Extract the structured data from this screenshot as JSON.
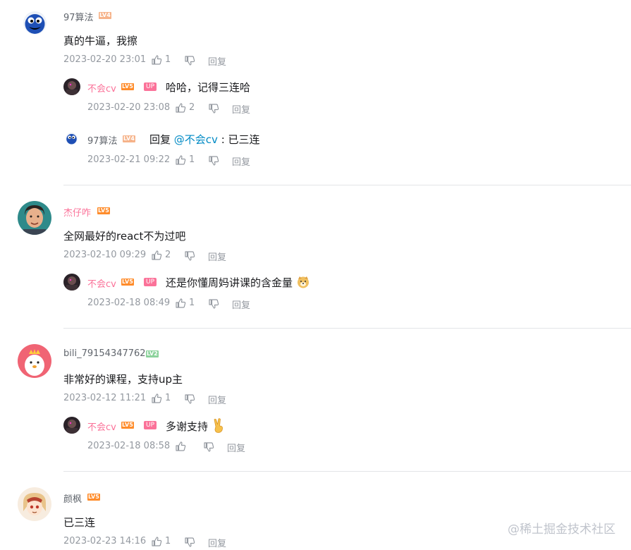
{
  "comments": [
    {
      "user": "97算法",
      "level": "LV4",
      "text": "真的牛逼，我擦",
      "time": "2023-02-20 23:01",
      "likes": "1",
      "reply_label": "回复",
      "replies": [
        {
          "user": "不会cv",
          "level": "LV5",
          "up": "UP",
          "text": "哈哈，记得三连哈",
          "time": "2023-02-20 23:08",
          "likes": "2",
          "reply_label": "回复"
        },
        {
          "user": "97算法",
          "level": "LV4",
          "reply_prefix": "回复",
          "mention": "@不会cv",
          "text": ": 已三连",
          "time": "2023-02-21 09:22",
          "likes": "1",
          "reply_label": "回复"
        }
      ]
    },
    {
      "user": "杰仔咋",
      "level": "LV5",
      "text": "全网最好的react不为过吧",
      "time": "2023-02-10 09:29",
      "likes": "2",
      "reply_label": "回复",
      "replies": [
        {
          "user": "不会cv",
          "level": "LV5",
          "up": "UP",
          "text": "还是你懂周妈讲课的含金量",
          "time": "2023-02-18 08:49",
          "likes": "1",
          "reply_label": "回复"
        }
      ]
    },
    {
      "user": "bili_79154347762",
      "level": "LV2",
      "text": "非常好的课程，支持up主",
      "time": "2023-02-12 11:21",
      "likes": "1",
      "reply_label": "回复",
      "replies": [
        {
          "user": "不会cv",
          "level": "LV5",
          "up": "UP",
          "text": "多谢支持",
          "time": "2023-02-18 08:58",
          "likes": "",
          "reply_label": "回复"
        }
      ]
    },
    {
      "user": "颜枫",
      "level": "LV5",
      "text": "已三连",
      "time": "2023-02-23 14:16",
      "likes": "1",
      "reply_label": "回复",
      "replies": []
    }
  ],
  "watermark": "@稀土掘金技术社区",
  "colors": {
    "pink": "#fb7299",
    "mention": "#008ac5",
    "meta": "#9499a0"
  }
}
